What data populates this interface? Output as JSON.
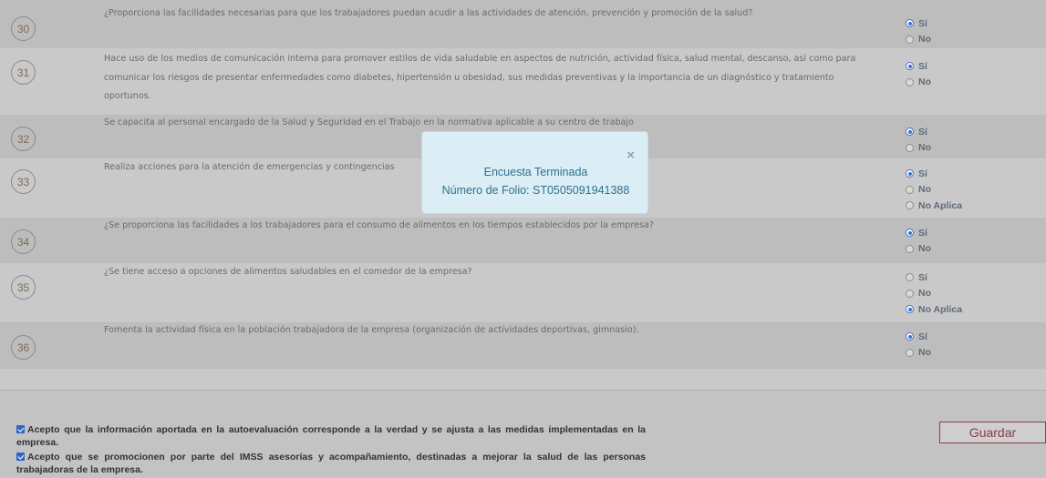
{
  "questions": [
    {
      "number": "30",
      "text": "¿Proporciona las facilidades necesarias para que los trabajadores puedan acudir a las actividades de atención, prevención y promoción de la salud?",
      "options": [
        {
          "label": "Sí",
          "selected": true
        },
        {
          "label": "No",
          "selected": false
        }
      ]
    },
    {
      "number": "31",
      "text": "Hace uso de los medios de comunicación interna para promover estilos de vida saludable en aspectos de nutrición, actividad física, salud mental, descanso, así como para comunicar los riesgos de presentar enfermedades como diabetes, hipertensión u obesidad, sus medidas preventivas y la importancia de un diagnóstico y tratamiento oportunos.",
      "options": [
        {
          "label": "Sí",
          "selected": true
        },
        {
          "label": "No",
          "selected": false
        }
      ]
    },
    {
      "number": "32",
      "text": "Se capacita al personal encargado de la Salud y Seguridad en el Trabajo en la normativa aplicable a su centro de trabajo",
      "options": [
        {
          "label": "Sí",
          "selected": true
        },
        {
          "label": "No",
          "selected": false
        }
      ]
    },
    {
      "number": "33",
      "text": "Realiza acciones para la atención de emergencias y contingencias",
      "options": [
        {
          "label": "Sí",
          "selected": true
        },
        {
          "label": "No",
          "selected": false
        },
        {
          "label": "No Aplica",
          "selected": false
        }
      ]
    },
    {
      "number": "34",
      "text": "¿Se proporciona las facilidades a los trabajadores para el consumo de alimentos en los tiempos establecidos por la empresa?",
      "options": [
        {
          "label": "Sí",
          "selected": true
        },
        {
          "label": "No",
          "selected": false
        }
      ]
    },
    {
      "number": "35",
      "text": "¿Se tiene acceso a opciones de alimentos saludables en el comedor de la empresa?",
      "options": [
        {
          "label": "Sí",
          "selected": false
        },
        {
          "label": "No",
          "selected": false
        },
        {
          "label": "No Aplica",
          "selected": true
        }
      ]
    },
    {
      "number": "36",
      "text": "Fomenta la actividad física en la población trabajadora de la empresa (organización de actividades deportivas, gimnasio).",
      "options": [
        {
          "label": "Sí",
          "selected": true
        },
        {
          "label": "No",
          "selected": false
        }
      ]
    }
  ],
  "footer": {
    "accept1": "Acepto que la información aportada en la autoevaluación corresponde a la verdad y se ajusta a las medidas implementadas en la empresa.",
    "accept2": "Acepto que se promocionen por parte del IMSS asesorías y acompañamiento, destinadas a mejorar la salud de las personas trabajadoras de la empresa.",
    "save_label": "Guardar"
  },
  "modal": {
    "close_glyph": "×",
    "title": "Encuesta Terminada",
    "folio": "Número de Folio: ST0505091941388"
  },
  "colors": {
    "radio_selected": "#3b6fd0",
    "modal_text": "#31708f",
    "save_border": "#8b3a4a"
  }
}
